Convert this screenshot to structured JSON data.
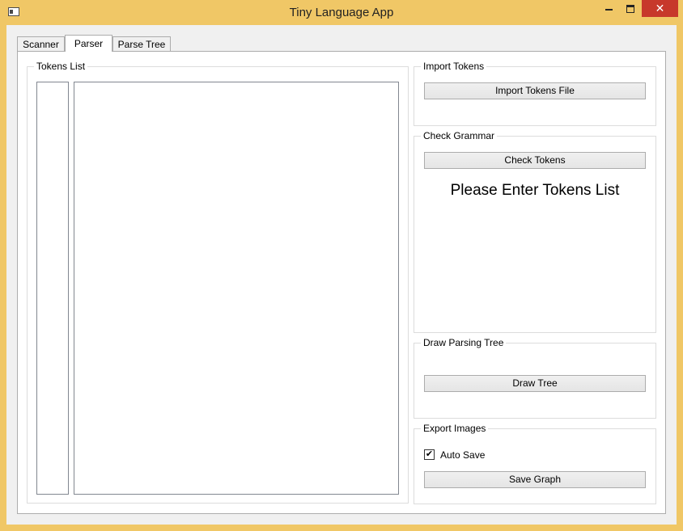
{
  "window": {
    "title": "Tiny Language App",
    "close_glyph": "✕"
  },
  "tabs": [
    {
      "label": "Scanner"
    },
    {
      "label": "Parser"
    },
    {
      "label": "Parse Tree"
    }
  ],
  "tokens_group": {
    "label": "Tokens List"
  },
  "import_group": {
    "label": "Import Tokens",
    "button": "Import Tokens File"
  },
  "check_group": {
    "label": "Check Grammar",
    "button": "Check Tokens",
    "message": "Please Enter Tokens List"
  },
  "draw_group": {
    "label": "Draw Parsing Tree",
    "button": "Draw Tree"
  },
  "export_group": {
    "label": "Export Images",
    "checkbox_label": "Auto Save",
    "checkbox_checked": true,
    "check_glyph": "✔",
    "button": "Save Graph"
  },
  "colors": {
    "frame": "#f0c766",
    "close_button": "#c7382b"
  }
}
